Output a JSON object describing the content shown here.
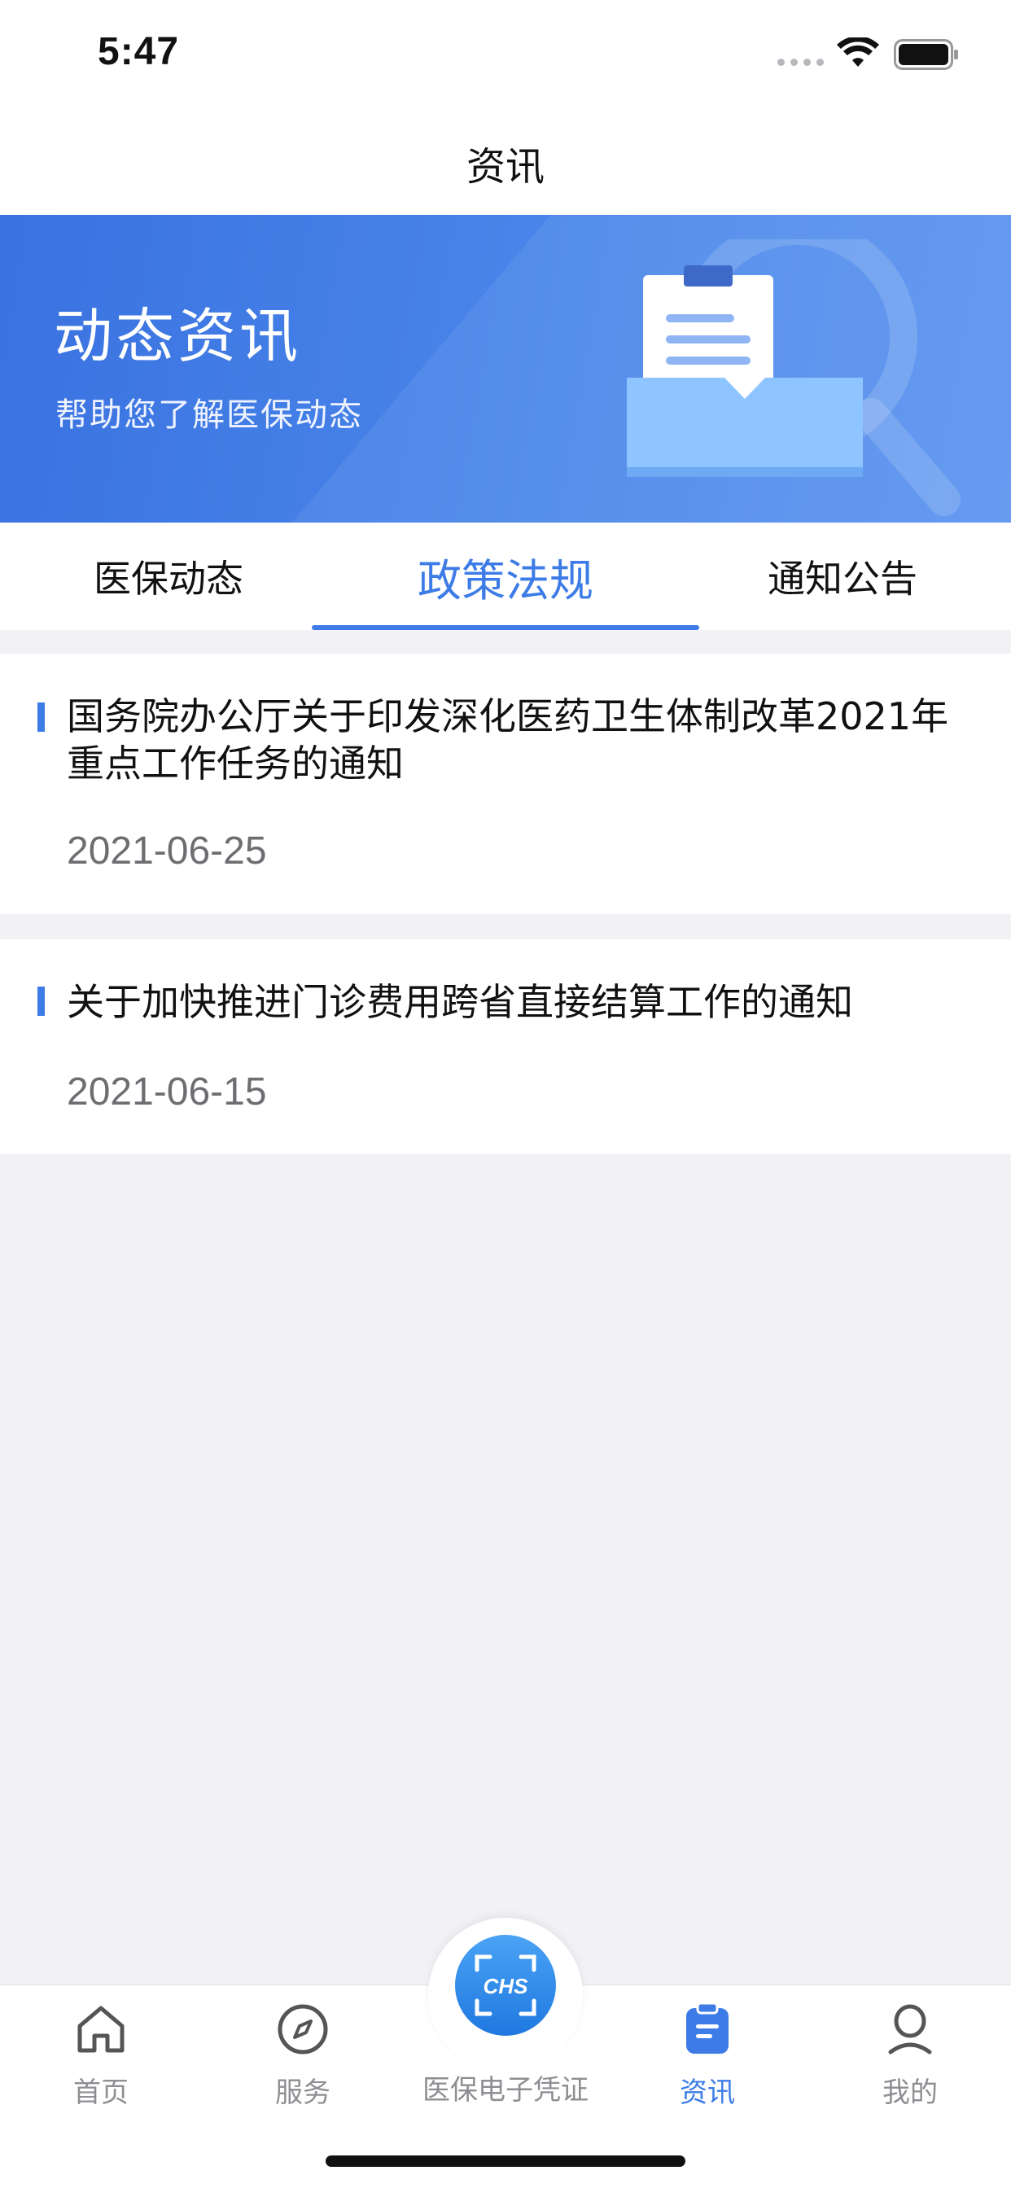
{
  "status_bar": {
    "time": "5:47"
  },
  "nav": {
    "title": "资讯"
  },
  "banner": {
    "title": "动态资讯",
    "subtitle": "帮助您了解医保动态"
  },
  "tabs": [
    {
      "label": "医保动态",
      "active": false
    },
    {
      "label": "政策法规",
      "active": true
    },
    {
      "label": "通知公告",
      "active": false
    }
  ],
  "news": [
    {
      "title": "国务院办公厅关于印发深化医药卫生体制改革2021年重点工作任务的通知",
      "date": "2021-06-25"
    },
    {
      "title": "关于加快推进门诊费用跨省直接结算工作的通知",
      "date": "2021-06-15"
    }
  ],
  "tab_bar": {
    "items": [
      {
        "label": "首页",
        "icon": "home-icon"
      },
      {
        "label": "服务",
        "icon": "compass-icon"
      },
      {
        "label": "医保电子凭证",
        "icon": "chs-scan-icon"
      },
      {
        "label": "资讯",
        "icon": "clipboard-icon",
        "active": true
      },
      {
        "label": "我的",
        "icon": "user-icon"
      }
    ],
    "center_logo_text": "CHS"
  },
  "colors": {
    "accent": "#3d7ce6",
    "banner": "#4a86ea",
    "inactive": "#8e8e93"
  }
}
